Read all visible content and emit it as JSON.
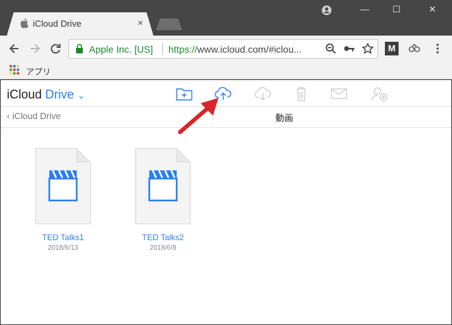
{
  "browser": {
    "tab_title": "iCloud Drive",
    "tab_close": "×",
    "minimize": "—",
    "maximize": "☐",
    "close": "✕",
    "cert_label": "Apple Inc. [US]",
    "url_green": "https://",
    "url_rest": "www.icloud.com/#iclou...",
    "extension_label": "M",
    "bookmark_apps": "アプリ"
  },
  "app": {
    "title_prefix": "iCloud",
    "title_drive": "Drive",
    "title_chevron": "⌄",
    "back_label": "iCloud Drive",
    "folder_title": "動画"
  },
  "files": [
    {
      "name": "TED Talks1",
      "date": "2018/6/13"
    },
    {
      "name": "TED Talks2",
      "date": "2018/6/8"
    }
  ],
  "colors": {
    "accent": "#2a7ff0",
    "secure_green": "#1b8a2c",
    "disabled": "#cfcfcf",
    "arrow_red": "#d9252b"
  },
  "icons": {
    "upload": "cloud-upload-icon",
    "new_folder": "new-folder-icon",
    "download": "cloud-download-icon",
    "delete": "trash-icon",
    "mail": "mail-icon",
    "share": "add-person-icon"
  }
}
